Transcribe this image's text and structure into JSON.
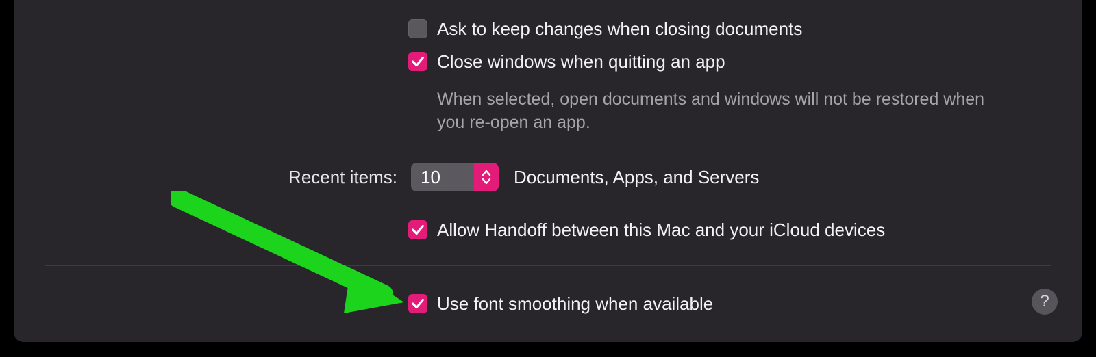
{
  "accent": "#E31C79",
  "options": {
    "ask_keep_changes": {
      "label": "Ask to keep changes when closing documents",
      "checked": false
    },
    "close_windows": {
      "label": "Close windows when quitting an app",
      "checked": true,
      "description": "When selected, open documents and windows will not be restored when you re-open an app."
    },
    "allow_handoff": {
      "label": "Allow Handoff between this Mac and your iCloud devices",
      "checked": true
    },
    "font_smoothing": {
      "label": "Use font smoothing when available",
      "checked": true
    }
  },
  "recent_items": {
    "label": "Recent items:",
    "value": "10",
    "suffix": "Documents, Apps, and Servers"
  },
  "help_label": "?"
}
